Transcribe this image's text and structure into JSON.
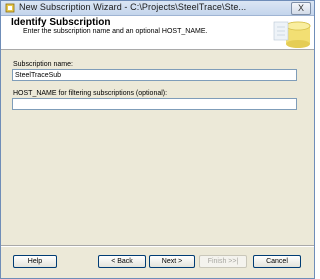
{
  "window": {
    "title": "New Subscription Wizard - C:\\Projects\\SteelTrace\\Ste...",
    "close_label": "X"
  },
  "header": {
    "title": "Identify Subscription",
    "subtitle": "Enter the subscription name and an optional HOST_NAME."
  },
  "form": {
    "subscription_name_label": "Subscription name:",
    "subscription_name_value": "SteelTraceSub",
    "host_name_label": "HOST_NAME for filtering subscriptions (optional):",
    "host_name_value": ""
  },
  "buttons": {
    "help": "Help",
    "back": "< Back",
    "next": "Next >",
    "finish": "Finish >>|",
    "cancel": "Cancel"
  },
  "colors": {
    "title_bar": "#c4d5ec",
    "dialog_background": "#ece9d8",
    "button_border": "#003c74"
  },
  "icons": {
    "app": "wizard-app-icon",
    "header": "database-cylinder-icon"
  }
}
